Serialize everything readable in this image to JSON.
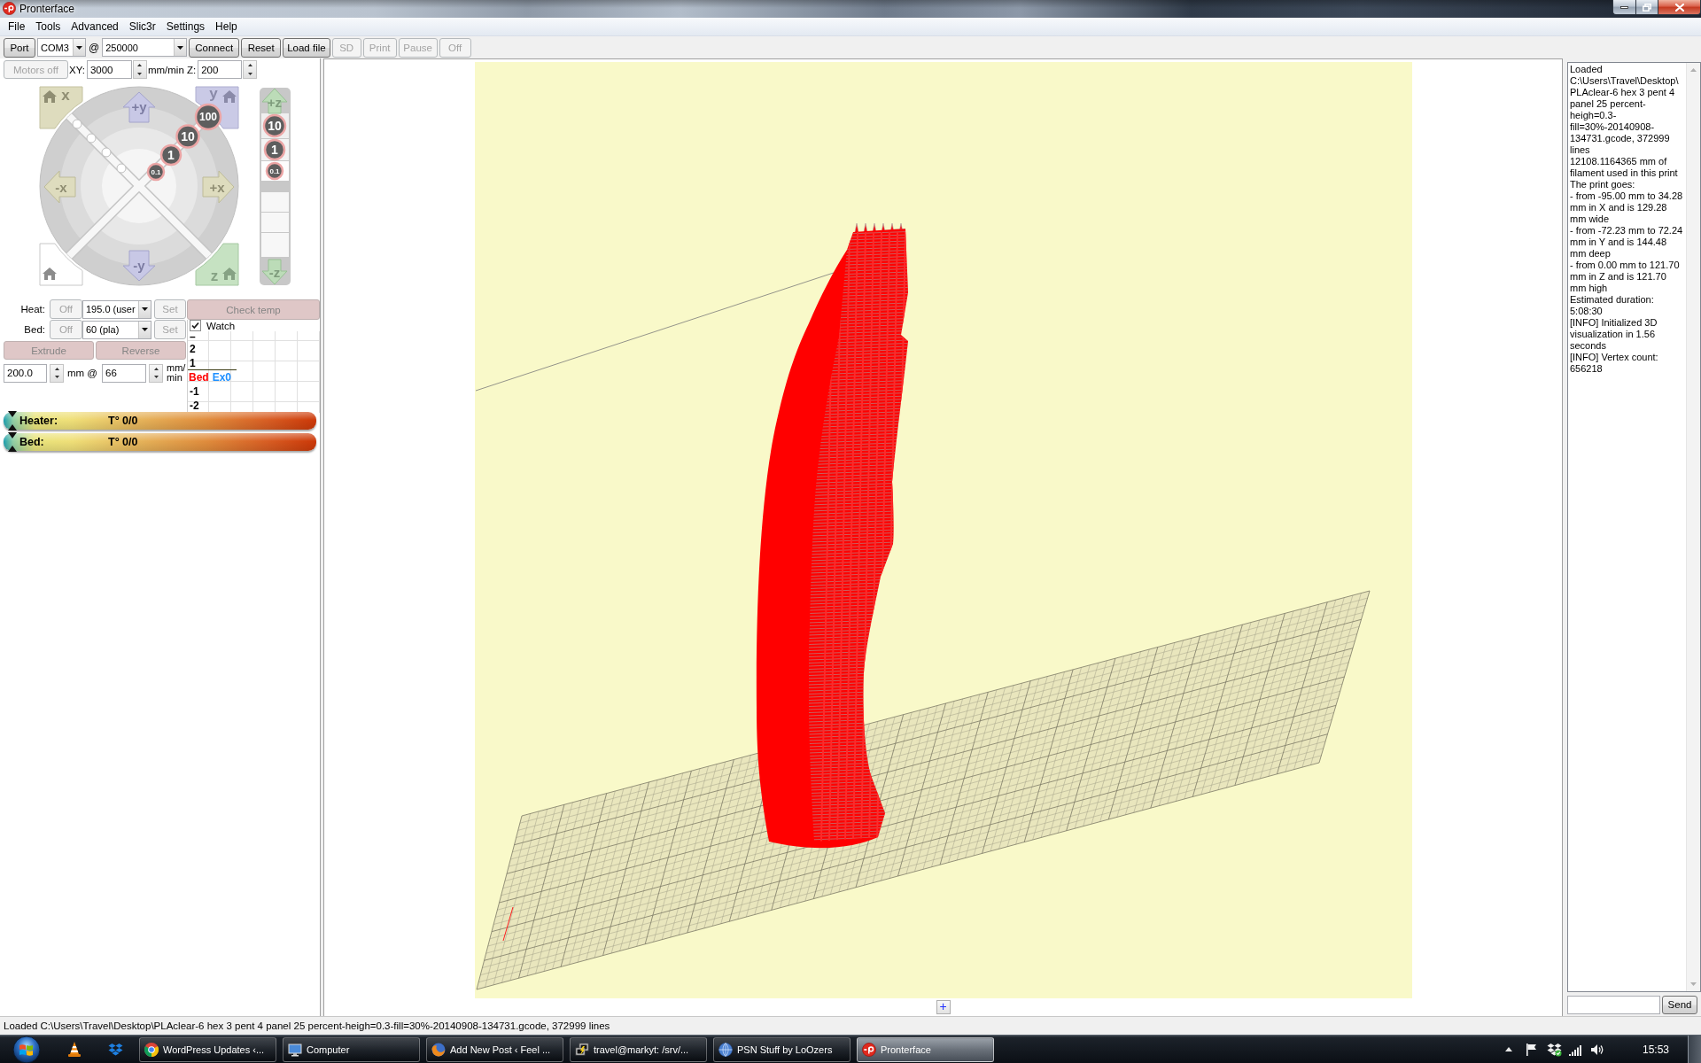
{
  "window": {
    "title": "Pronterface"
  },
  "menu": [
    "File",
    "Tools",
    "Advanced",
    "Slic3r",
    "Settings",
    "Help"
  ],
  "toolbar": {
    "port_button": "Port",
    "port": "COM3",
    "at": "@",
    "baud_rate": "250000",
    "buttons": [
      {
        "label": "Connect",
        "disabled": false
      },
      {
        "label": "Reset",
        "disabled": false
      },
      {
        "label": "Load file",
        "disabled": false
      },
      {
        "label": "SD",
        "disabled": true
      },
      {
        "label": "Print",
        "disabled": true
      },
      {
        "label": "Pause",
        "disabled": true
      },
      {
        "label": "Off",
        "disabled": true
      }
    ]
  },
  "motion": {
    "motors_off": {
      "label": "Motors off",
      "disabled": true
    },
    "xy_label": "XY:",
    "xy_speed": "3000",
    "z_label": "mm/min Z:",
    "z_speed": "200"
  },
  "xy_jog": {
    "home_x": "x",
    "plus_y": "+y",
    "home_y": "y",
    "minus_x": "-x",
    "plus_x": "+x",
    "minus_y": "-y",
    "home_z": "z",
    "steps": [
      "100",
      "10",
      "1",
      "0.1"
    ]
  },
  "z_jog": {
    "plus_z": "+z",
    "steps": [
      "10",
      "1",
      "0.1"
    ],
    "minus_z": "-z"
  },
  "temperature": {
    "heaters": [
      {
        "label": "Heat:",
        "off": {
          "label": "Off",
          "disabled": true
        },
        "value": "195.0 (user",
        "set": {
          "label": "Set",
          "disabled": true
        }
      },
      {
        "label": "Bed:",
        "off": {
          "label": "Off",
          "disabled": true
        },
        "value": "60 (pla)",
        "set": {
          "label": "Set",
          "disabled": true
        }
      }
    ],
    "check_temp": {
      "label": "Check temp",
      "disabled": true
    },
    "watch": {
      "label": "Watch",
      "checked": true
    }
  },
  "extrusion": {
    "buttons": [
      {
        "label": "Extrude",
        "disabled": true
      },
      {
        "label": "Reverse",
        "disabled": true
      }
    ],
    "length": "200.0",
    "length_unit": "mm @",
    "feedrate": "66",
    "feedrate_unit": "mm/ min"
  },
  "temp_graph": {
    "y_labels": [
      "–",
      "2",
      "1",
      "-1",
      "-2"
    ],
    "legend": [
      {
        "label": "Bed",
        "color": "#ff0000"
      },
      {
        "label": "Ex0",
        "color": "#1e90ff"
      }
    ]
  },
  "gauges": [
    {
      "label": "Heater:",
      "reading": "T° 0/0",
      "level": 0
    },
    {
      "label": "Bed:",
      "reading": "T° 0/0",
      "level": 0
    }
  ],
  "viewport": {
    "add_button": "+"
  },
  "log": {
    "lines": [
      "Loaded C:\\Users\\Travel\\Desktop\\PLAclear-6 hex 3 pent 4 panel 25 percent-heigh=0.3-fill=30%-20140908-134731.gcode, 372999 lines",
      "12108.1164365 mm of filament used in this print",
      "The print goes:",
      "- from -95.00 mm to 34.28 mm in X and is 129.28 mm wide",
      "- from -72.23 mm to 72.24 mm in Y and is 144.48 mm deep",
      "- from 0.00 mm to 121.70 mm in Z and is 121.70 mm high",
      "Estimated duration: 5:08:30",
      "[INFO] Initialized 3D visualization in 1.56 seconds",
      "[INFO] Vertex count: 656218"
    ]
  },
  "command": {
    "send_button": "Send"
  },
  "status_bar": "Loaded C:\\Users\\Travel\\Desktop\\PLAclear-6 hex 3 pent 4 panel 25 percent-heigh=0.3-fill=30%-20140908-134731.gcode, 372999 lines",
  "taskbar": {
    "tasks": [
      {
        "label": "WordPress Updates ‹...",
        "selected": false
      },
      {
        "label": "Computer",
        "selected": false
      },
      {
        "label": "Add New Post ‹ Feel ...",
        "selected": false
      },
      {
        "label": "travel@markyt: /srv/...",
        "selected": false
      },
      {
        "label": "PSN Stuff by LoOzers",
        "selected": false
      },
      {
        "label": "Pronterface",
        "selected": true
      }
    ],
    "clock": "15:53"
  }
}
